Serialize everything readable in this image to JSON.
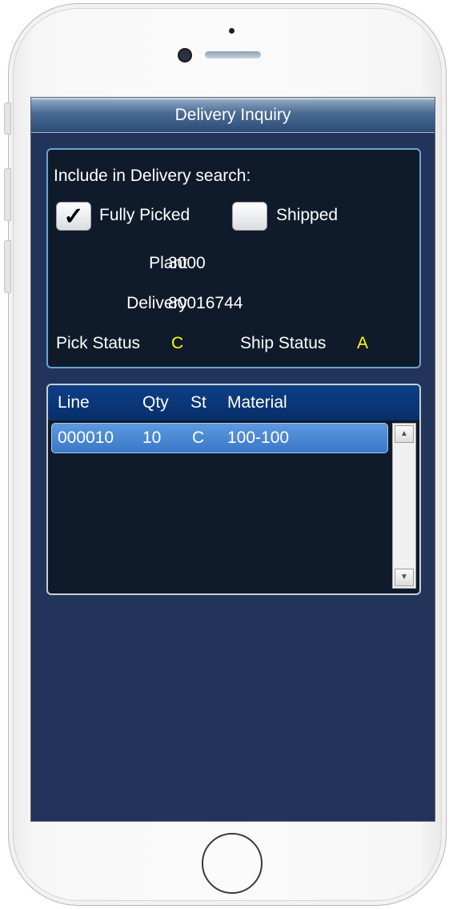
{
  "app": {
    "title": "Delivery Inquiry"
  },
  "criteria": {
    "heading": "Include in Delivery search:",
    "fully_picked": {
      "label": "Fully Picked",
      "checked": true,
      "mark": "✓"
    },
    "shipped": {
      "label": "Shipped",
      "checked": false
    },
    "plant": {
      "label": "Plant",
      "value": "3000"
    },
    "delivery": {
      "label": "Delivery",
      "value": "80016744"
    },
    "pick_status": {
      "label": "Pick Status",
      "value": "C"
    },
    "ship_status": {
      "label": "Ship Status",
      "value": "A"
    }
  },
  "grid": {
    "columns": [
      "Line",
      "Qty",
      "St",
      "Material"
    ],
    "rows": [
      {
        "line": "000010",
        "qty": "10",
        "st": "C",
        "material": "100-100"
      }
    ]
  },
  "colors": {
    "accent_yellow": "#ffff00",
    "selection": "#4a89d6",
    "screen_bg": "#22345a"
  },
  "icons": [
    "checkmark-icon",
    "scroll-up-arrow-icon",
    "scroll-down-arrow-icon"
  ]
}
